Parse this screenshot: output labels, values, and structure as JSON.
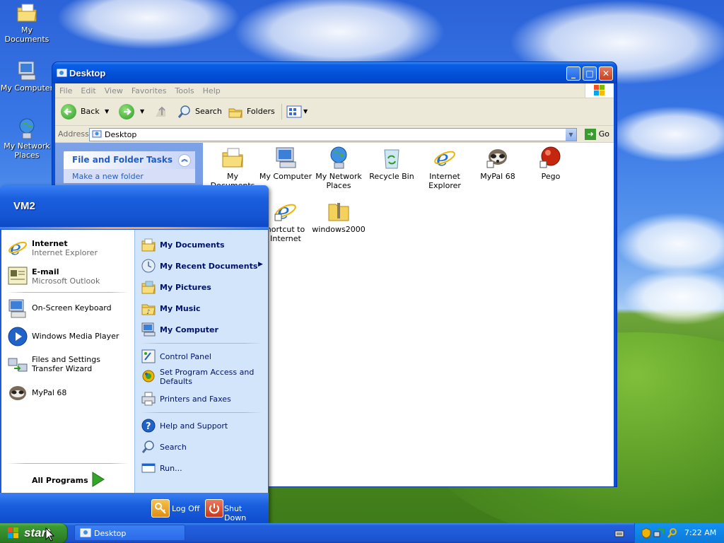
{
  "desktop": {
    "icons": [
      {
        "label": "My Documents",
        "icon": "my-documents-icon"
      },
      {
        "label": "My Computer",
        "icon": "my-computer-icon"
      },
      {
        "label": "My Network Places",
        "icon": "network-places-icon"
      }
    ]
  },
  "explorer": {
    "title": "Desktop",
    "menu": [
      "File",
      "Edit",
      "View",
      "Favorites",
      "Tools",
      "Help"
    ],
    "toolbar": {
      "back": "Back",
      "search": "Search",
      "folders": "Folders"
    },
    "address": {
      "label": "Address",
      "value": "Desktop",
      "go": "Go"
    },
    "taskpane": {
      "title": "File and Folder Tasks",
      "item": "Make a new folder"
    },
    "items": [
      {
        "label": "My Documents",
        "icon": "my-documents-icon"
      },
      {
        "label": "My Computer",
        "icon": "my-computer-icon"
      },
      {
        "label": "My Network Places",
        "icon": "network-places-icon"
      },
      {
        "label": "Recycle Bin",
        "icon": "recycle-bin-icon"
      },
      {
        "label": "Internet Explorer",
        "icon": "internet-explorer-icon"
      },
      {
        "label": "MyPal 68",
        "icon": "mypal-icon"
      },
      {
        "label": "Pego",
        "icon": "pego-icon"
      },
      {
        "label": "hortcut to Internet",
        "icon": "ie-shortcut-icon"
      },
      {
        "label": "windows2000",
        "icon": "zip-folder-icon"
      }
    ]
  },
  "startmenu": {
    "user": "VM2",
    "pinned": [
      {
        "title": "Internet",
        "subtitle": "Internet Explorer"
      },
      {
        "title": "E-mail",
        "subtitle": "Microsoft Outlook"
      }
    ],
    "recent": [
      "On-Screen Keyboard",
      "Windows Media Player",
      "Files and Settings Transfer Wizard",
      "MyPal 68"
    ],
    "all_programs": "All Programs",
    "right": {
      "my_documents": "My Documents",
      "my_recent": "My Recent Documents",
      "my_pictures": "My Pictures",
      "my_music": "My Music",
      "my_computer": "My Computer",
      "control_panel": "Control Panel",
      "set_program": "Set Program Access and Defaults",
      "printers": "Printers and Faxes",
      "help": "Help and Support",
      "search": "Search",
      "run": "Run..."
    },
    "log_off": "Log Off",
    "shut_down": "Shut Down"
  },
  "taskbar": {
    "start": "start",
    "task": "Desktop",
    "clock": "7:22 AM"
  },
  "colors": {
    "taskbar_blue": "#245edb",
    "start_green": "#3c9a33",
    "menu_text": "#00136b"
  }
}
